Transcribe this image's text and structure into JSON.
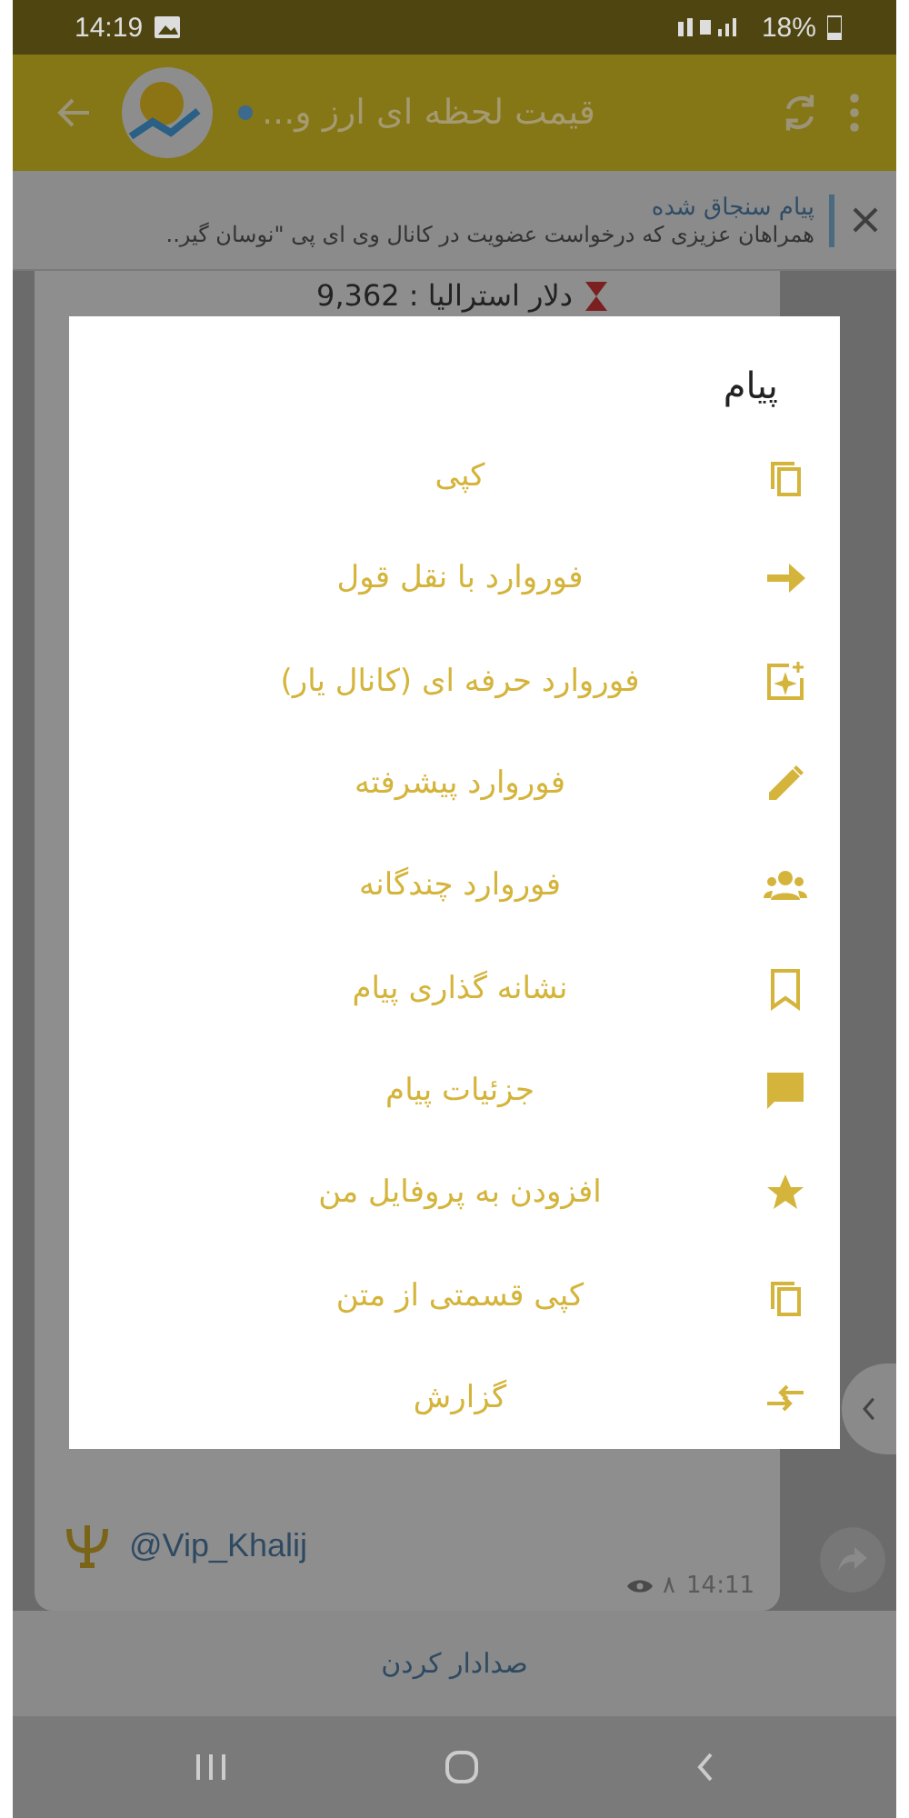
{
  "status_bar": {
    "time": "14:19",
    "battery": "18%"
  },
  "header": {
    "title": "قیمت لحظه ای ارز و..."
  },
  "pinned": {
    "title": "پیام سنجاق شده",
    "text": "همراهان عزیزی که درخواست عضویت در کانال وی ای پی \"نوسان گیر.."
  },
  "message": {
    "line": "دلار استرالیا : 9,362",
    "signature": "@Vip_Khalij",
    "views": "٨",
    "time": "14:11"
  },
  "dialog": {
    "title": "پیام",
    "items": [
      {
        "label": "کپی",
        "kind": "copy"
      },
      {
        "label": "فوروارد با نقل قول",
        "kind": "quote"
      },
      {
        "label": "فوروارد حرفه ای (کانال یار)",
        "kind": "pro"
      },
      {
        "label": "فوروارد پیشرفته",
        "kind": "advanced"
      },
      {
        "label": "فوروارد چندگانه",
        "kind": "multi"
      },
      {
        "label": "نشانه گذاری پیام",
        "kind": "bookmark"
      },
      {
        "label": "جزئیات پیام",
        "kind": "details"
      },
      {
        "label": "افزودن به پروفایل من",
        "kind": "profile"
      },
      {
        "label": "کپی قسمتی از متن",
        "kind": "copypart"
      },
      {
        "label": "گزارش",
        "kind": "report"
      }
    ]
  },
  "bottom_bar": {
    "action": "صدادار کردن"
  }
}
